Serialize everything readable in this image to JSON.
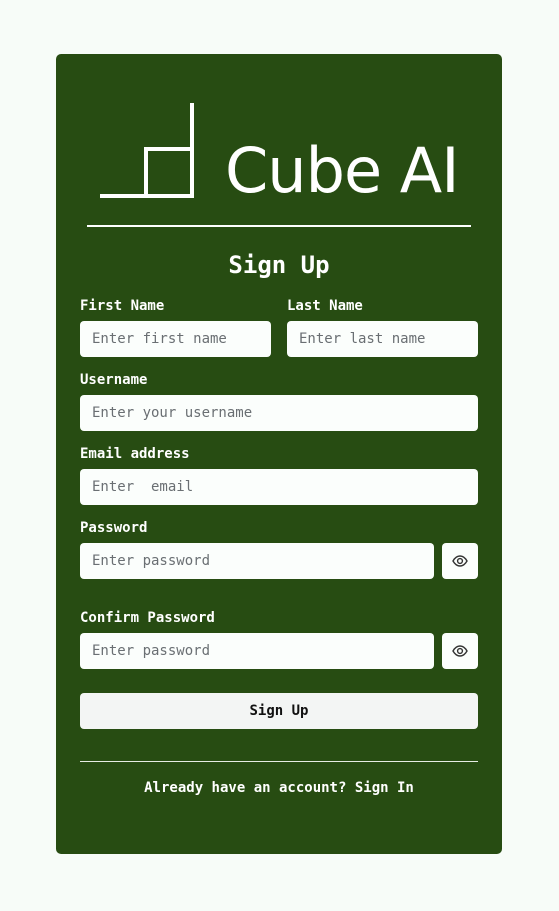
{
  "brand": {
    "name": "Cube AI",
    "logo_icon": "cube-logo-icon"
  },
  "form": {
    "title": "Sign Up",
    "first_name": {
      "label": "First Name",
      "placeholder": "Enter first name",
      "value": ""
    },
    "last_name": {
      "label": "Last Name",
      "placeholder": "Enter last name",
      "value": ""
    },
    "username": {
      "label": "Username",
      "placeholder": "Enter your username",
      "value": ""
    },
    "email": {
      "label": "Email address",
      "placeholder": "Enter  email",
      "value": ""
    },
    "password": {
      "label": "Password",
      "placeholder": "Enter password",
      "value": "",
      "toggle_icon": "eye-icon"
    },
    "confirm_password": {
      "label": "Confirm Password",
      "placeholder": "Enter password",
      "value": "",
      "toggle_icon": "eye-icon"
    },
    "submit_label": "Sign Up"
  },
  "footer": {
    "prompt": "Already have an account?",
    "link_label": "Sign In"
  },
  "colors": {
    "page_background": "#f7fcf8",
    "card_background": "#274c12",
    "input_background": "#fbfefc",
    "button_background": "#f3f5f4",
    "text_light": "#ffffff"
  }
}
